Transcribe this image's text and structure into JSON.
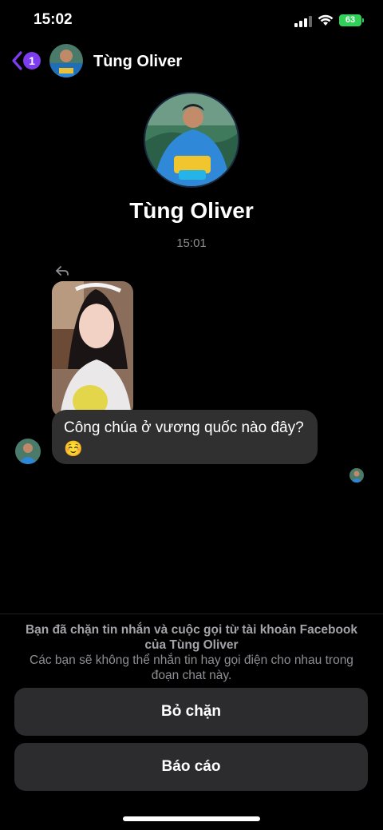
{
  "status_bar": {
    "time": "15:02",
    "battery": "63"
  },
  "header": {
    "unread_count": "1",
    "contact_name": "Tùng Oliver"
  },
  "profile": {
    "name": "Tùng Oliver",
    "timestamp": "15:01"
  },
  "message": {
    "text": "Công chúa ở vương quốc nào đây? ☺️"
  },
  "blocked_notice": {
    "title": "Bạn đã chặn tin nhắn và cuộc gọi từ tài khoản Facebook của Tùng Oliver",
    "note": "Các bạn sẽ không thể nhắn tin hay gọi điện cho nhau trong đoạn chat này."
  },
  "actions": {
    "unblock_label": "Bỏ chặn",
    "report_label": "Báo cáo"
  },
  "colors": {
    "accent": "#7d3cf0",
    "battery": "#30d158",
    "bubble": "#303030",
    "button": "#2c2c2e"
  }
}
